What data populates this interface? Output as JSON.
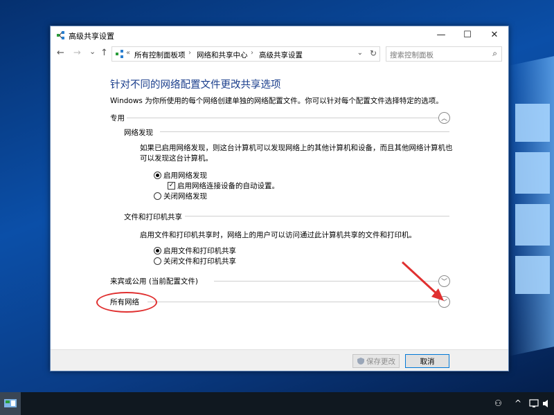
{
  "window": {
    "title": "高级共享设置",
    "controls": {
      "minimize": "—",
      "maximize": "☐",
      "close": "✕"
    }
  },
  "nav": {
    "back": "←",
    "forward": "→",
    "recent": "⌄",
    "up": "↑",
    "address_prefix": "«",
    "breadcrumb": [
      "所有控制面板项",
      "网络和共享中心",
      "高级共享设置"
    ],
    "breadcrumb_sep": "›",
    "dropdown": "⌄",
    "refresh": "↻",
    "search_placeholder": "搜索控制面板",
    "search_icon": "⌕"
  },
  "main": {
    "title": "针对不同的网络配置文件更改共享选项",
    "description": "Windows 为你所使用的每个网络创建单独的网络配置文件。你可以针对每个配置文件选择特定的选项。",
    "sections": {
      "private": {
        "label": "专用",
        "expanded": true,
        "network_discovery": {
          "title": "网络发现",
          "text_line1": "如果已启用网络发现，则这台计算机可以发现网络上的其他计算机和设备，而且其他网络计算机也",
          "text_line2": "可以发现这台计算机。",
          "opt_on": "启用网络发现",
          "opt_auto": "启用网络连接设备的自动设置。",
          "opt_off": "关闭网络发现",
          "selected": "on",
          "auto_checked": true
        },
        "file_print": {
          "title": "文件和打印机共享",
          "text": "启用文件和打印机共享时，网络上的用户可以访问通过此计算机共享的文件和打印机。",
          "opt_on": "启用文件和打印机共享",
          "opt_off": "关闭文件和打印机共享",
          "selected": "on"
        }
      },
      "guest_public": {
        "label": "来宾或公用 (当前配置文件)",
        "expanded": false
      },
      "all_networks": {
        "label": "所有网络",
        "expanded": false
      }
    },
    "chevron_up": "︿",
    "chevron_down": "﹀"
  },
  "footer": {
    "save": "保存更改",
    "cancel": "取消"
  },
  "annotation_color": "#e03030"
}
